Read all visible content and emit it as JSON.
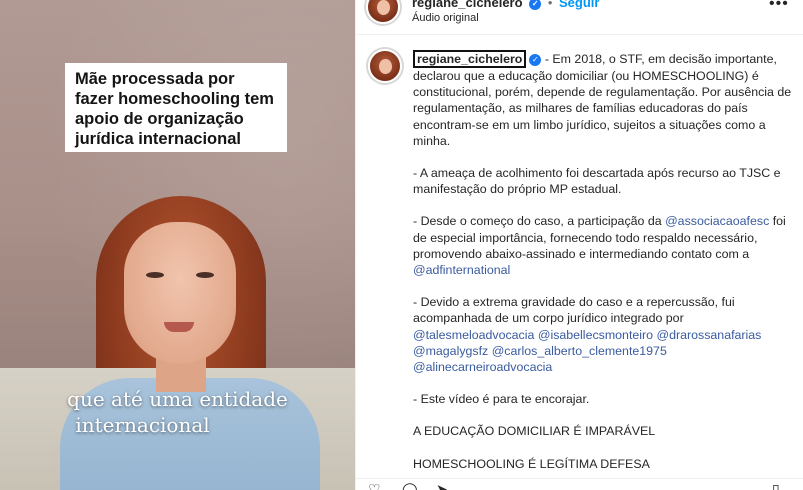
{
  "video": {
    "headline": "Mãe processada por fazer homeschooling tem apoio de organização jurídica internacional",
    "caption_line1": "que até uma entidade",
    "caption_line2": "internacional"
  },
  "header": {
    "username": "regiane_cichelero",
    "separator": "•",
    "follow": "Seguir",
    "audio": "Áudio original",
    "more": "•••"
  },
  "post": {
    "username": "regiane_cichelero",
    "p1": "- Em 2018, o STF, em decisão importante, declarou que a educação domiciliar (ou HOMESCHOOLING) é constitucional, porém, depende de regulamentação. Por ausência de regulamentação, as milhares de famílias educadoras do país encontram-se em um limbo jurídico, sujeitos a situações como a minha.",
    "p2": "- A ameaça de acolhimento foi descartada após recurso ao TJSC e manifestação do próprio MP estadual.",
    "p3a": "- Desde o começo do caso, a participação da ",
    "p3_mention1": "@associacaoafesc",
    "p3b": " foi de especial importância, fornecendo todo respaldo necessário, promovendo abaixo-assinado e intermediando contato com a ",
    "p3_mention2": "@adfinternational",
    "p4a": "- Devido a extrema gravidade do caso e a repercussão, fui acompanhada de um corpo jurídico integrado por ",
    "p4_m1": "@talesmeloadvocacia",
    "p4_m2": "@isabellecsmonteiro",
    "p4_m3": "@drarossanafarias",
    "p4_m4": "@magalygsfz",
    "p4_m5": "@carlos_alberto_clemente1975",
    "p4_m6": "@alinecarneiroadvocacia",
    "p5": "- Este vídeo é para te encorajar.",
    "p6": "A EDUCAÇÃO DOMICILIAR É IMPARÁVEL",
    "p7": "HOMESCHOOLING É LEGÍTIMA DEFESA"
  },
  "icons": [
    "heart-icon",
    "comment-icon",
    "share-icon",
    "bookmark-icon",
    "verified-icon",
    "more-icon"
  ],
  "colors": {
    "link": "#0095f6",
    "mention": "#00376b",
    "verified": "#1877f2"
  }
}
